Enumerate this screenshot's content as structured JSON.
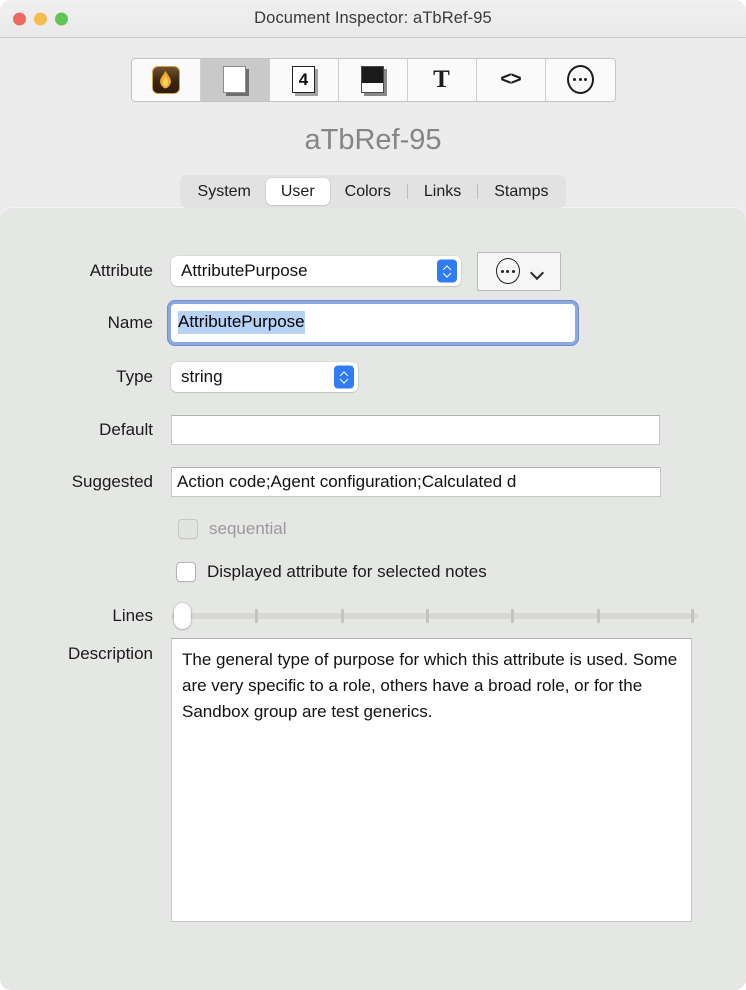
{
  "window": {
    "title": "Document Inspector: aTbRef-95",
    "traffic_lights": [
      "close-button",
      "minimize-button",
      "zoom-button"
    ]
  },
  "toolbar": {
    "items": [
      {
        "name": "tinderbox-flame-icon",
        "glyph": "flame",
        "selected": true
      },
      {
        "name": "document-icon",
        "glyph": "document",
        "selected": false
      },
      {
        "name": "document-number-icon",
        "glyph": "document-4",
        "label": "4",
        "selected": false
      },
      {
        "name": "document-half-icon",
        "glyph": "document-half",
        "selected": false
      },
      {
        "name": "text-icon",
        "glyph": "T",
        "label": "T",
        "selected": false
      },
      {
        "name": "code-icon",
        "glyph": "code",
        "label": "<>",
        "selected": false
      },
      {
        "name": "more-options-icon",
        "glyph": "ellipsis-circle",
        "selected": false
      }
    ]
  },
  "heading": "aTbRef-95",
  "tabs": [
    {
      "label": "System",
      "active": false
    },
    {
      "label": "User",
      "active": true
    },
    {
      "label": "Colors",
      "active": false
    },
    {
      "label": "Links",
      "active": false
    },
    {
      "label": "Stamps",
      "active": false
    }
  ],
  "form": {
    "attribute": {
      "label": "Attribute",
      "value": "AttributePurpose"
    },
    "attribute_menu": {
      "name": "attribute-actions-menu",
      "icon": "ellipsis-circle-icon"
    },
    "name": {
      "label": "Name",
      "value": "AttributePurpose",
      "selected": true,
      "focused": true
    },
    "type": {
      "label": "Type",
      "value": "string"
    },
    "default": {
      "label": "Default",
      "value": "",
      "placeholder": ""
    },
    "suggested": {
      "label": "Suggested",
      "value": "Action code;Agent configuration;Calculated d"
    },
    "sequential": {
      "label": "sequential",
      "checked": false,
      "disabled": true
    },
    "displayed_attribute": {
      "label": "Displayed attribute for selected notes",
      "checked": false,
      "disabled": false
    },
    "lines": {
      "label": "Lines",
      "value": 0,
      "min": 0,
      "max": 7,
      "tick_count": 6
    },
    "description": {
      "label": "Description",
      "value": "The general type of purpose for which this attribute is used. Some are very specific to a role, others have a broad role, or for the Sandbox group are test generics."
    }
  },
  "colors": {
    "window_bg": "#ececec",
    "panel_bg": "#e5e7e4",
    "accent_blue": "#2f7cf6",
    "focus_ring": "#8ca8e0",
    "selection_blue": "#b6d2f5",
    "heading_gray": "#858585",
    "dim_text": "#9a9a9a"
  }
}
